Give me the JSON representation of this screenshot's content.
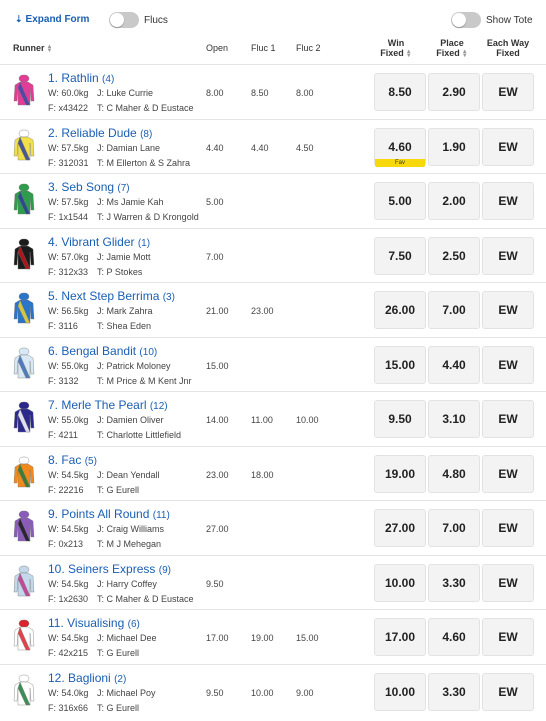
{
  "controls": {
    "expand_label": "Expand Form",
    "flucs_label": "Flucs",
    "show_tote_label": "Show Tote"
  },
  "columns": {
    "runner": "Runner",
    "open": "Open",
    "fluc1": "Fluc 1",
    "fluc2": "Fluc 2",
    "win_1": "Win",
    "win_2": "Fixed",
    "place_1": "Place",
    "place_2": "Fixed",
    "ew_1": "Each Way",
    "ew_2": "Fixed"
  },
  "fav_label": "Fav",
  "runners": [
    {
      "name": "1. Rathlin",
      "barrier": "(4)",
      "weight": "W: 60.0kg",
      "jockey": "J: Luke Currie",
      "form": "F: x43422",
      "trainer": "T: C Maher & D Eustace",
      "open": "8.00",
      "fluc1": "8.50",
      "fluc2": "8.00",
      "win": "8.50",
      "place": "2.90",
      "ew": "EW",
      "fav": false,
      "silk": [
        "#e23c97",
        "#3a4ba8",
        "#e23c97"
      ]
    },
    {
      "name": "2. Reliable Dude",
      "barrier": "(8)",
      "weight": "W: 57.5kg",
      "jockey": "J: Damian Lane",
      "form": "F: 312031",
      "trainer": "T: M Ellerton & S Zahra",
      "open": "4.40",
      "fluc1": "4.40",
      "fluc2": "4.50",
      "win": "4.60",
      "place": "1.90",
      "ew": "EW",
      "fav": true,
      "silk": [
        "#f2e04a",
        "#2d3f9e",
        "#ffffff"
      ]
    },
    {
      "name": "3. Seb Song",
      "barrier": "(7)",
      "weight": "W: 57.5kg",
      "jockey": "J: Ms Jamie Kah",
      "form": "F: 1x1544",
      "trainer": "T: J Warren & D Krongold",
      "open": "5.00",
      "fluc1": "",
      "fluc2": "",
      "win": "5.00",
      "place": "2.00",
      "ew": "EW",
      "fav": false,
      "silk": [
        "#2e9c4a",
        "#2c3e9c",
        "#2e9c4a"
      ]
    },
    {
      "name": "4. Vibrant Glider",
      "barrier": "(1)",
      "weight": "W: 57.0kg",
      "jockey": "J: Jamie Mott",
      "form": "F: 312x33",
      "trainer": "T: P Stokes",
      "open": "7.00",
      "fluc1": "",
      "fluc2": "",
      "win": "7.50",
      "place": "2.50",
      "ew": "EW",
      "fav": false,
      "silk": [
        "#1b1b1b",
        "#c4161c",
        "#1b1b1b"
      ]
    },
    {
      "name": "5. Next Step Berrima",
      "barrier": "(3)",
      "weight": "W: 56.5kg",
      "jockey": "J: Mark Zahra",
      "form": "F: 3116",
      "trainer": "T: Shea Eden",
      "open": "21.00",
      "fluc1": "23.00",
      "fluc2": "",
      "win": "26.00",
      "place": "7.00",
      "ew": "EW",
      "fav": false,
      "silk": [
        "#2a74c9",
        "#f0d52c",
        "#2a74c9"
      ]
    },
    {
      "name": "6. Bengal Bandit",
      "barrier": "(10)",
      "weight": "W: 55.0kg",
      "jockey": "J: Patrick Moloney",
      "form": "F: 3132",
      "trainer": "T: M Price & M Kent Jnr",
      "open": "15.00",
      "fluc1": "",
      "fluc2": "",
      "win": "15.00",
      "place": "4.40",
      "ew": "EW",
      "fav": false,
      "silk": [
        "#d8e8f4",
        "#3a6ab0",
        "#d8e8f4"
      ]
    },
    {
      "name": "7. Merle The Pearl",
      "barrier": "(12)",
      "weight": "W: 55.0kg",
      "jockey": "J: Damien Oliver",
      "form": "F: 4211",
      "trainer": "T: Charlotte Littlefield",
      "open": "14.00",
      "fluc1": "11.00",
      "fluc2": "10.00",
      "win": "9.50",
      "place": "3.10",
      "ew": "EW",
      "fav": false,
      "silk": [
        "#2b2a8c",
        "#ffffff",
        "#2b2a8c"
      ]
    },
    {
      "name": "8. Fac",
      "barrier": "(5)",
      "weight": "W: 54.5kg",
      "jockey": "J: Dean Yendall",
      "form": "F: 22216",
      "trainer": "T: G Eurell",
      "open": "23.00",
      "fluc1": "18.00",
      "fluc2": "",
      "win": "19.00",
      "place": "4.80",
      "ew": "EW",
      "fav": false,
      "silk": [
        "#f08a1c",
        "#1d7a3a",
        "#ffffff"
      ]
    },
    {
      "name": "9. Points All Round",
      "barrier": "(11)",
      "weight": "W: 54.5kg",
      "jockey": "J: Craig Williams",
      "form": "F: 0x213",
      "trainer": "T: M J Mehegan",
      "open": "27.00",
      "fluc1": "",
      "fluc2": "",
      "win": "27.00",
      "place": "7.00",
      "ew": "EW",
      "fav": false,
      "silk": [
        "#8a5bb8",
        "#1b1b1b",
        "#8a5bb8"
      ]
    },
    {
      "name": "10. Seiners Express",
      "barrier": "(9)",
      "weight": "W: 54.5kg",
      "jockey": "J: Harry Coffey",
      "form": "F: 1x2630",
      "trainer": "T: C Maher & D Eustace",
      "open": "9.50",
      "fluc1": "",
      "fluc2": "",
      "win": "10.00",
      "place": "3.30",
      "ew": "EW",
      "fav": false,
      "silk": [
        "#c4d8ec",
        "#c2318a",
        "#c4d8ec"
      ]
    },
    {
      "name": "11. Visualising",
      "barrier": "(6)",
      "weight": "W: 54.5kg",
      "jockey": "J: Michael Dee",
      "form": "F: 42x215",
      "trainer": "T: G Eurell",
      "open": "17.00",
      "fluc1": "19.00",
      "fluc2": "15.00",
      "win": "17.00",
      "place": "4.60",
      "ew": "EW",
      "fav": false,
      "silk": [
        "#ffffff",
        "#d9242b",
        "#d9242b"
      ]
    },
    {
      "name": "12. Baglioni",
      "barrier": "(2)",
      "weight": "W: 54.0kg",
      "jockey": "J: Michael Poy",
      "form": "F: 316x66",
      "trainer": "T: G Eurell",
      "open": "9.50",
      "fluc1": "10.00",
      "fluc2": "9.00",
      "win": "10.00",
      "place": "3.30",
      "ew": "EW",
      "fav": false,
      "silk": [
        "#ffffff",
        "#1d7a3a",
        "#ffffff"
      ]
    }
  ]
}
